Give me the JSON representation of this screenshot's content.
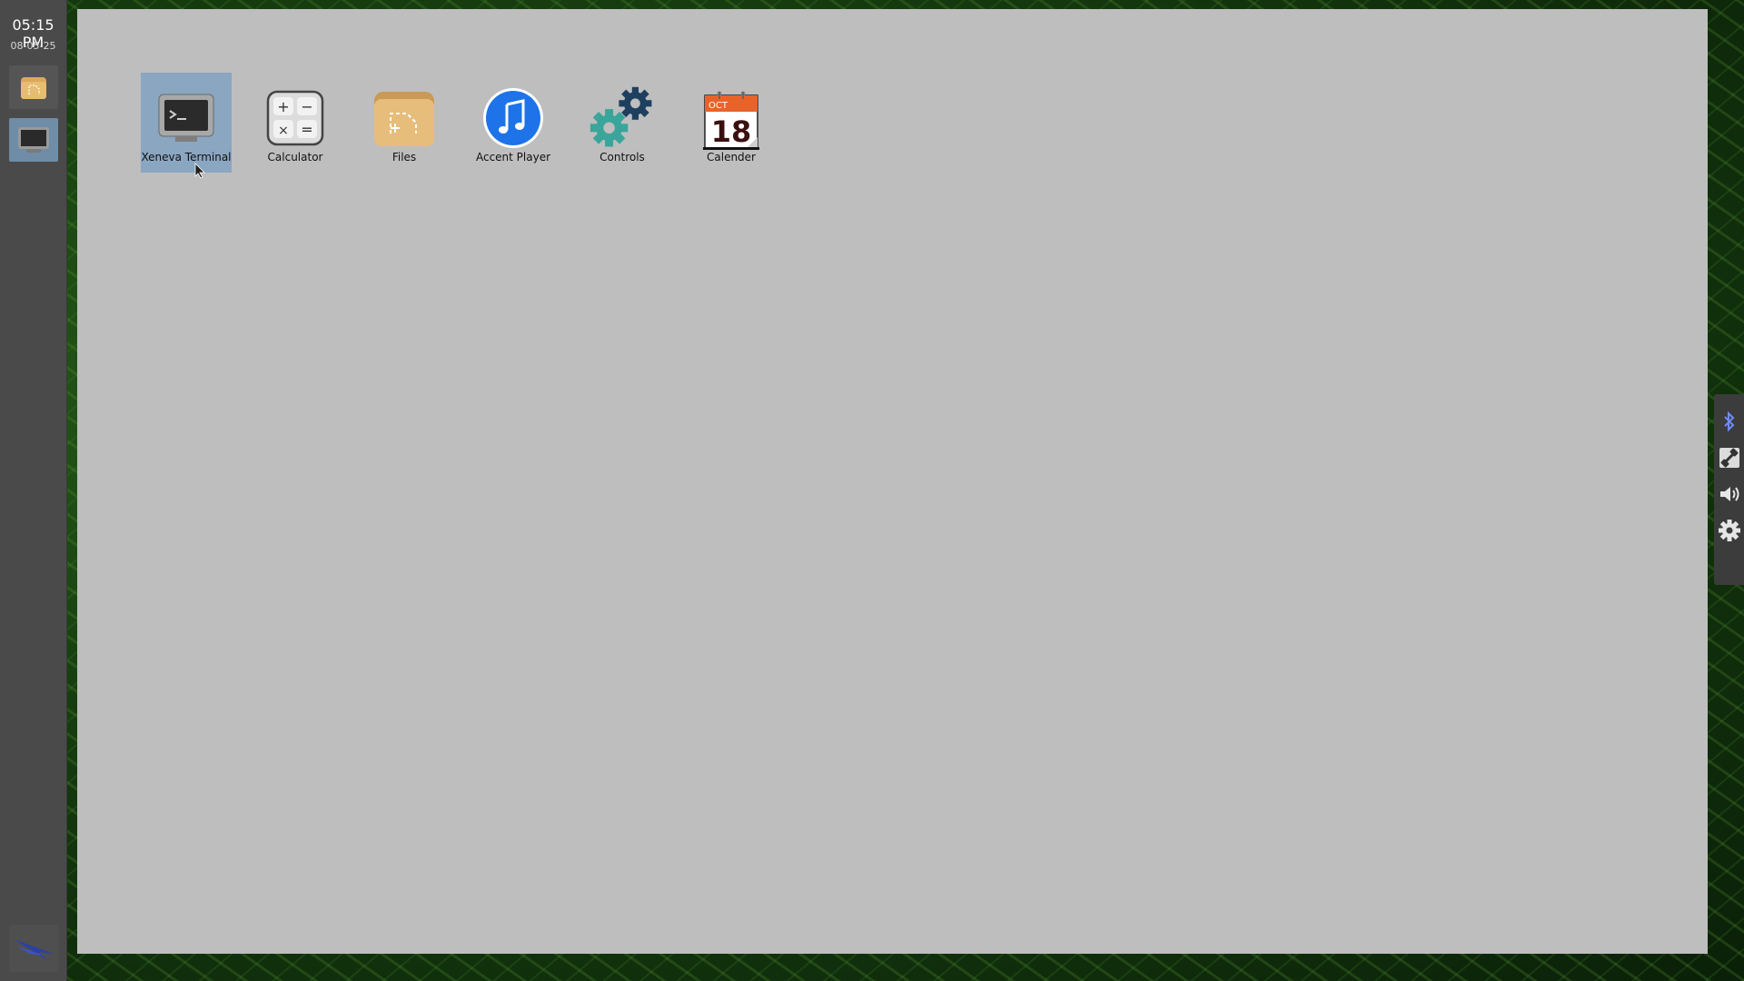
{
  "taskbar": {
    "time": "05:15 PM",
    "date": "08-05-25",
    "buttons": [
      {
        "name": "files",
        "icon": "folder-icon"
      },
      {
        "name": "terminal",
        "icon": "terminal-icon"
      }
    ],
    "logo_icon": "bird-logo-icon"
  },
  "desktop": {
    "icons": [
      {
        "label": "Xeneva Terminal",
        "icon": "terminal-icon",
        "selected": true
      },
      {
        "label": "Calculator",
        "icon": "calculator-icon"
      },
      {
        "label": "Files",
        "icon": "folder-icon"
      },
      {
        "label": "Accent Player",
        "icon": "music-note-icon"
      },
      {
        "label": "Controls",
        "icon": "gears-icon"
      },
      {
        "label": "Calender",
        "icon": "calendar-icon",
        "calendar_month": "OCT",
        "calendar_day": "18"
      }
    ]
  },
  "quick_panel": {
    "items": [
      "bluetooth-icon",
      "network-icon",
      "volume-icon",
      "settings-icon"
    ]
  },
  "colors": {
    "taskbar": "#4a4a4a",
    "window": "#bebebe",
    "selection": "#8aa6c1",
    "calendar_orange": "#e8632a",
    "player_blue": "#1e73e8",
    "gear_teal": "#3aa59a",
    "gear_navy": "#1f3f5f"
  }
}
